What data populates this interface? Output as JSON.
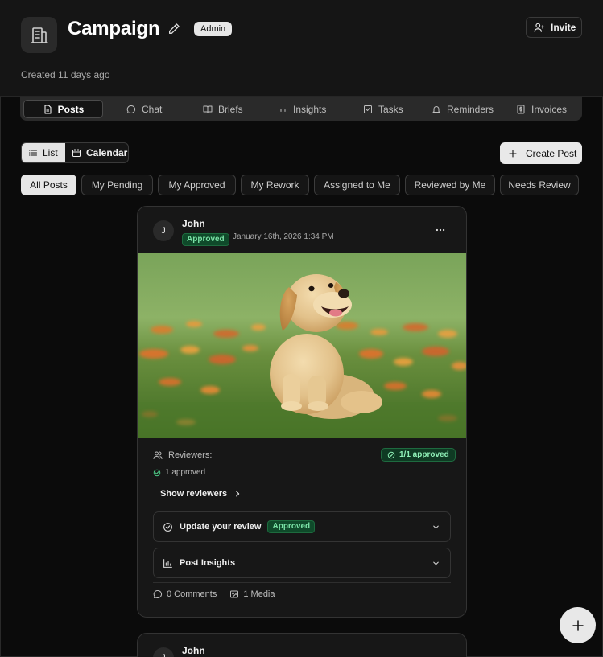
{
  "header": {
    "title": "Campaign",
    "role_badge": "Admin",
    "invite_label": "Invite",
    "created": "Created 11 days ago"
  },
  "tabs": [
    {
      "label": "Posts",
      "icon": "document-icon",
      "active": true
    },
    {
      "label": "Chat",
      "icon": "chat-bubble-icon"
    },
    {
      "label": "Briefs",
      "icon": "book-icon"
    },
    {
      "label": "Insights",
      "icon": "bar-chart-icon"
    },
    {
      "label": "Tasks",
      "icon": "checkbox-icon"
    },
    {
      "label": "Reminders",
      "icon": "bell-icon"
    },
    {
      "label": "Invoices",
      "icon": "dollar-receipt-icon"
    }
  ],
  "toolbar": {
    "list_label": "List",
    "calendar_label": "Calendar",
    "create_label": "Create Post"
  },
  "filters": [
    "All Posts",
    "My Pending",
    "My Approved",
    "My Rework",
    "Assigned to Me",
    "Reviewed by Me",
    "Needs Review"
  ],
  "post": {
    "avatar_initial": "J",
    "author": "John",
    "status": "Approved",
    "date": "January 16th, 2026 1:34 PM",
    "reviewers_label": "Reviewers:",
    "approved_count": "1 approved",
    "ratio_badge": "1/1 approved",
    "show_reviewers": "Show reviewers",
    "update_review": "Update your review",
    "review_status": "Approved",
    "insights_label": "Post Insights",
    "comments": "0 Comments",
    "media": "1 Media"
  },
  "post2": {
    "avatar_initial": "J",
    "author": "John"
  },
  "colors": {
    "background": "#0b0b0b",
    "approved_green": "#7ae2a6"
  }
}
